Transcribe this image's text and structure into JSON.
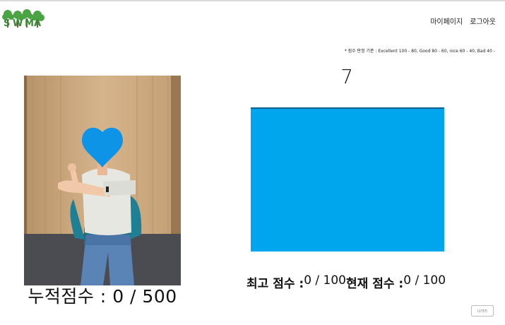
{
  "nav": {
    "mypage": "마이페이지",
    "logout": "로그아웃"
  },
  "criteria_text": "* 점수 판정 기준 : Excellent 100 - 80, Good 80 - 60, nice 60 - 40, Bad 40 -",
  "countdown": "7",
  "cumulative": {
    "label": "누적점수 : ",
    "value": "0 / 500"
  },
  "best": {
    "label": "최고 점수 : ",
    "value": "0 / 100"
  },
  "current": {
    "label": "현재 점수 : ",
    "value": "0 / 100"
  },
  "exit_label": "나가기",
  "colors": {
    "camera_fill": "#00a6ed",
    "logo_green": "#3f9b3f",
    "accent_blue": "#0d94e6"
  }
}
